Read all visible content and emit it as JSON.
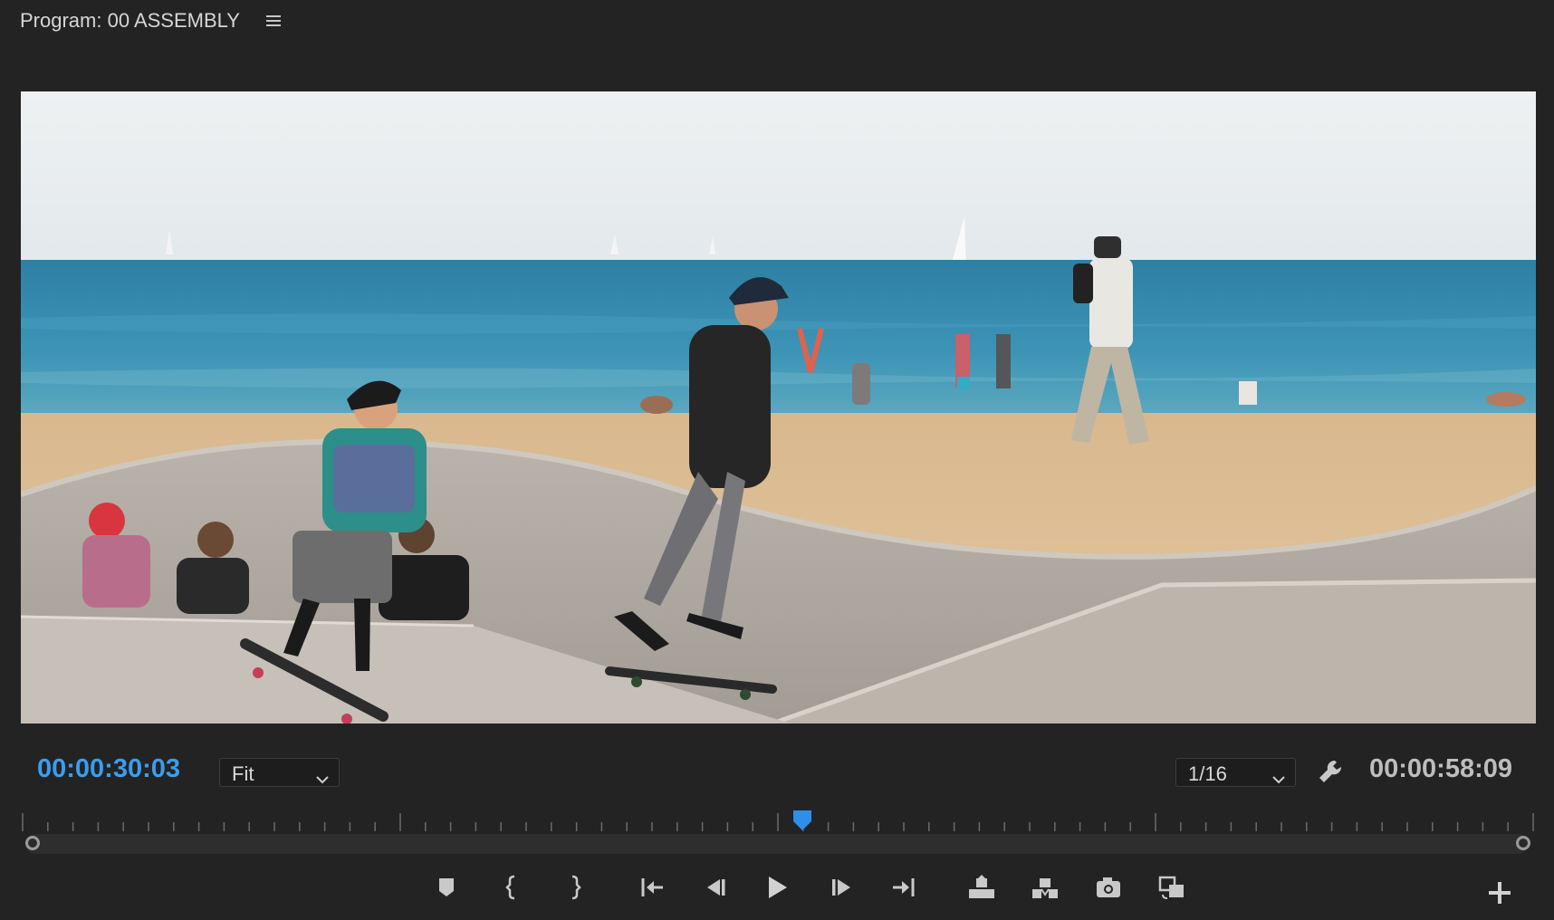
{
  "panel": {
    "title": "Program: 00 ASSEMBLY",
    "menu_icon": "hamburger-menu-icon"
  },
  "timecode": {
    "current": "00:00:30:03",
    "duration": "00:00:58:09"
  },
  "zoom_select": {
    "selected": "Fit"
  },
  "resolution_select": {
    "selected": "1/16"
  },
  "settings_icon": "wrench-icon",
  "playhead": {
    "position_fraction": 0.516
  },
  "colors": {
    "accent": "#3b9ded",
    "background": "#232323",
    "panel_text": "#d6d6d6"
  },
  "controls": [
    "add-marker-icon",
    "mark-in-icon",
    "mark-out-icon",
    "go-to-in-icon",
    "step-back-icon",
    "play-icon",
    "step-forward-icon",
    "go-to-out-icon",
    "lift-icon",
    "extract-icon",
    "export-frame-icon",
    "comparison-view-icon",
    "button-editor-plus-icon"
  ]
}
